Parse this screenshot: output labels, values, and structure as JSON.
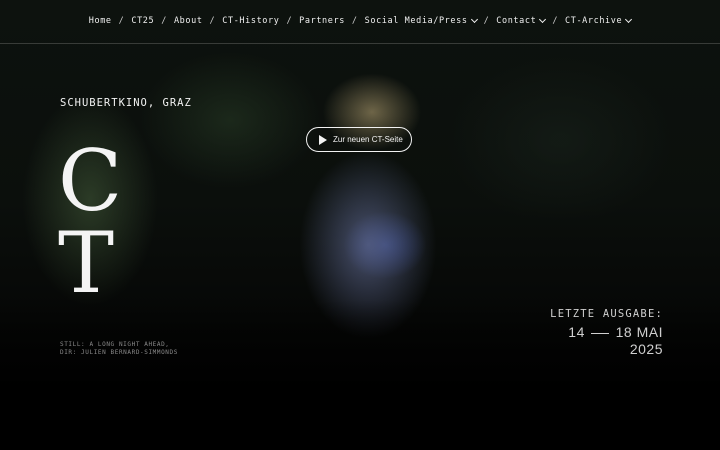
{
  "nav": {
    "items": [
      {
        "label": "Home",
        "dropdown": false
      },
      {
        "label": "CT25",
        "dropdown": false
      },
      {
        "label": "About",
        "dropdown": false
      },
      {
        "label": "CT-History",
        "dropdown": false
      },
      {
        "label": "Partners",
        "dropdown": false
      },
      {
        "label": "Social Media/Press",
        "dropdown": true
      },
      {
        "label": "Contact",
        "dropdown": true
      },
      {
        "label": "CT-Archive",
        "dropdown": true
      }
    ],
    "separator": "/"
  },
  "hero": {
    "venue": "SCHUBERTKINO, GRAZ",
    "logo_line1": "C",
    "logo_line2": "T",
    "play_button_label": "Zur neuen CT-Seite",
    "caption_line1": "STILL: A LONG NIGHT AHEAD,",
    "caption_line2": "DIR: JULIEN BERNARD-SIMMONDS",
    "edition_label": "LETZTE AUSGABE:",
    "edition_start": "14",
    "edition_end": "18 MAI",
    "edition_year": "2025"
  },
  "icons": {
    "play": "play-icon",
    "dropdown": "chevron-down-icon"
  }
}
